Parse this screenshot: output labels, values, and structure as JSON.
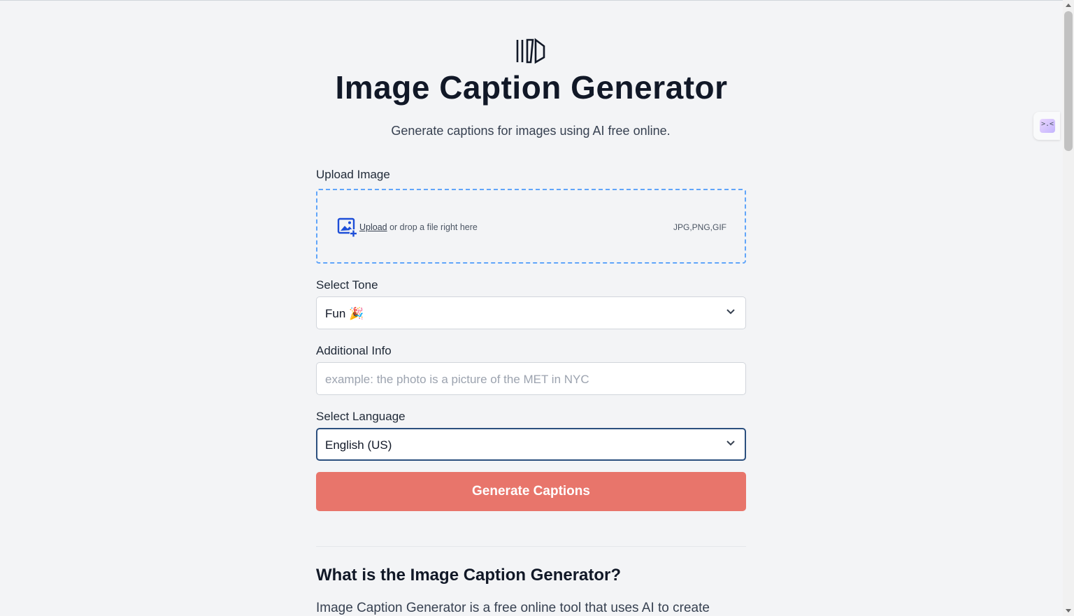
{
  "header": {
    "title": "Image Caption Generator",
    "subtitle": "Generate captions for images using AI free online."
  },
  "upload": {
    "label": "Upload Image",
    "link_text": "Upload",
    "drop_text": " or drop a file right here",
    "formats": "JPG,PNG,GIF",
    "icon": "image-add-icon"
  },
  "tone": {
    "label": "Select Tone",
    "selected": "Fun 🎉",
    "icon": "chevron-down-icon"
  },
  "additional_info": {
    "label": "Additional Info",
    "value": "",
    "placeholder": "example: the photo is a picture of the MET in NYC"
  },
  "language": {
    "label": "Select Language",
    "selected": "English (US)"
  },
  "generate_button": {
    "label": "Generate Captions"
  },
  "about": {
    "heading": "What is the Image Caption Generator?",
    "text": "Image Caption Generator is a free online tool that uses AI to create"
  },
  "extension": {
    "glyph": ">.<"
  },
  "colors": {
    "accent": "#e8756b",
    "dropzone_border": "#60a5fa",
    "focus_border": "#2b4f7e",
    "upload_icon": "#1d4ed8"
  }
}
